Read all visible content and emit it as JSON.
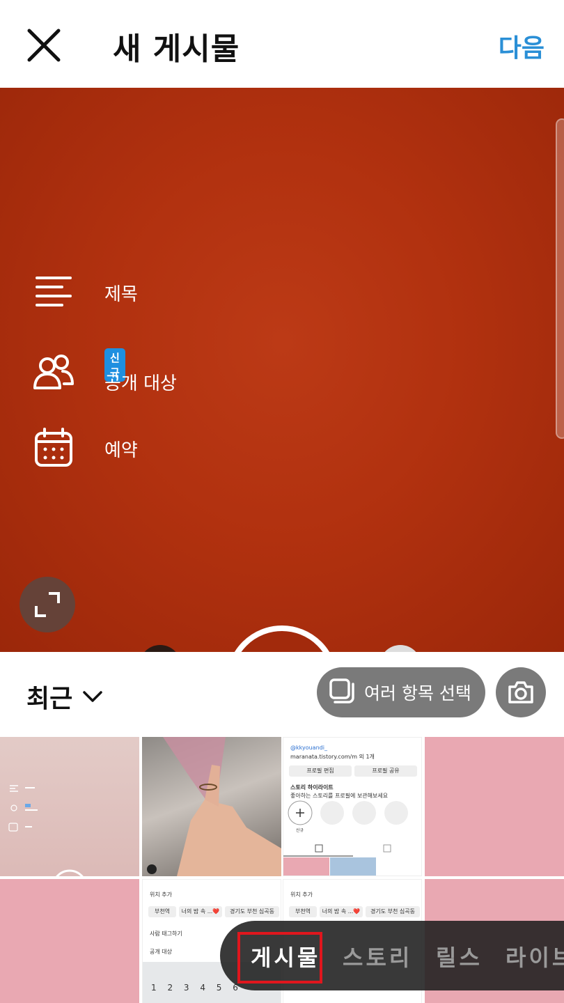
{
  "header": {
    "title": "새 게시물",
    "next_label": "다음"
  },
  "preview": {
    "options": {
      "title_label": "제목",
      "audience_label": "공개 대상",
      "audience_badge": "신규",
      "schedule_label": "예약"
    }
  },
  "toolbar": {
    "album_label": "최근",
    "multi_select_label": "여러 항목 선택"
  },
  "thumbnails": {
    "profile_handle": "@kkyouandi_",
    "profile_link": "maranata.tistory.com/m 외 1개",
    "edit_profile": "프로필 편집",
    "share_profile": "프로필 공유",
    "story_highlights": "스토리 하이라이트",
    "story_highlights_desc": "좋아하는 스토리를 프로필에 보관해보세요",
    "new_label": "신규",
    "add_location": "위치 추가",
    "chip_1": "부천역",
    "chip_2": "너의 밤 속 ...❤️",
    "chip_3": "경기도 부천 심곡동",
    "tag_people": "사람 태그하기",
    "audience": "공개 대상",
    "keyboard_numbers": "1 2 3 4 5 6"
  },
  "modes": {
    "post": "게시물",
    "story": "스토리",
    "reels": "릴스",
    "live": "라이브"
  },
  "colors": {
    "accent": "#2a8fd6",
    "badge": "#1f8fe0",
    "preview_bg": "#b1310f",
    "highlight": "#e0161d"
  }
}
